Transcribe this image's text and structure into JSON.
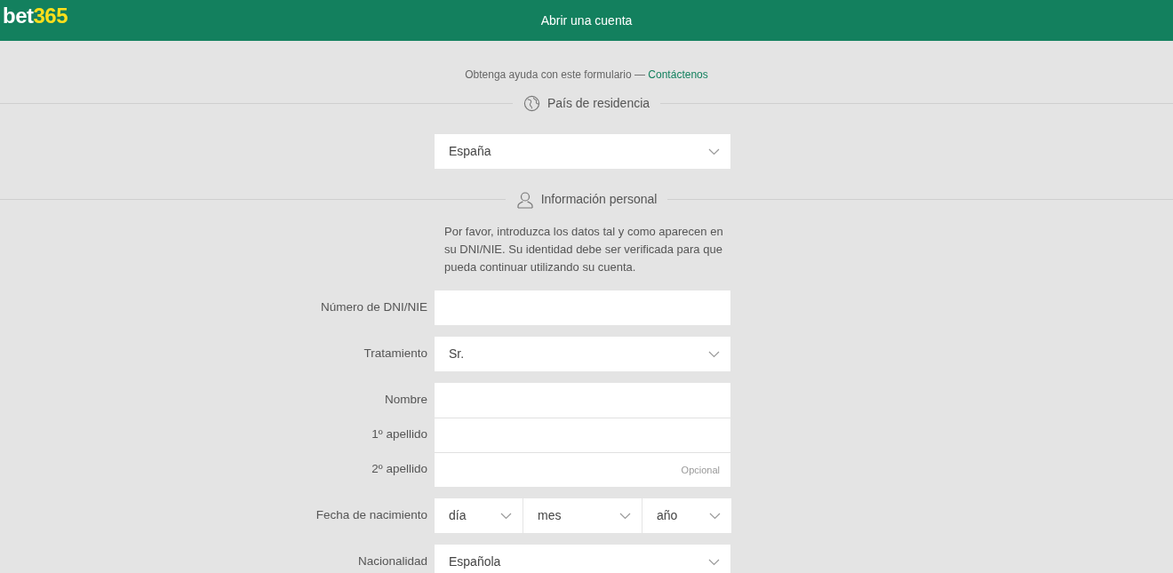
{
  "header": {
    "logo": {
      "part_1": "bet",
      "part_2": "365"
    },
    "title": "Abrir una cuenta"
  },
  "help": {
    "text": "Obtenga ayuda con este formulario —",
    "link": "Contáctenos"
  },
  "country_section": {
    "heading": "País de residencia",
    "select": {
      "value": "España"
    }
  },
  "personal_section": {
    "heading": "Información personal",
    "intro": "Por favor, introduzca los datos tal y como aparecen en su DNI/NIE. Su identidad debe ser verificada para que pueda continuar utilizando su cuenta.",
    "rows": [
      {
        "kind": "text",
        "label": "Número de DNI/NIE"
      },
      {
        "kind": "select",
        "label": "Tratamiento",
        "value": "Sr."
      },
      {
        "kind": "group",
        "fields": [
          {
            "label": "Nombre"
          },
          {
            "label": "1º apellido"
          },
          {
            "label": "2º apellido",
            "placeholder": "Opcional"
          }
        ]
      },
      {
        "kind": "date",
        "label": "Fecha de nacimiento",
        "parts": [
          "día",
          "mes",
          "año"
        ]
      },
      {
        "kind": "select",
        "label": "Nacionalidad",
        "value": "Española"
      }
    ]
  }
}
